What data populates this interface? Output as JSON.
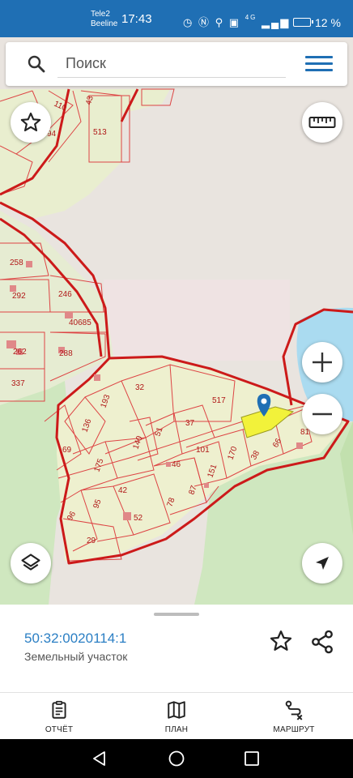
{
  "status_bar": {
    "carrier_1": "Tele2",
    "carrier_2": "Beeline",
    "time": "17:43",
    "network": "4G",
    "battery_percent": "12 %"
  },
  "search": {
    "placeholder": "Поиск"
  },
  "map": {
    "parcel_labels": [
      "110",
      "43",
      "94",
      "513",
      "258",
      "292",
      "246",
      "40685",
      "262",
      "288",
      "337",
      "32",
      "193",
      "517",
      "136",
      "69",
      "37",
      "51",
      "140",
      "175",
      "101",
      "170",
      "46",
      "151",
      "38",
      "66",
      "87",
      "81",
      "42",
      "95",
      "78",
      "52",
      "96",
      "29"
    ],
    "highlight_color": "#f2f23a",
    "boundary_color": "#cc1a1a",
    "water_color": "#aadbf0",
    "forest_color": "#cfe7bf"
  },
  "info_sheet": {
    "cadastral_number": "50:32:0020114:1",
    "object_type": "Земельный участок"
  },
  "bottom_nav": {
    "report_label": "ОТЧЁТ",
    "plan_label": "ПЛАН",
    "route_label": "МАРШРУТ"
  }
}
